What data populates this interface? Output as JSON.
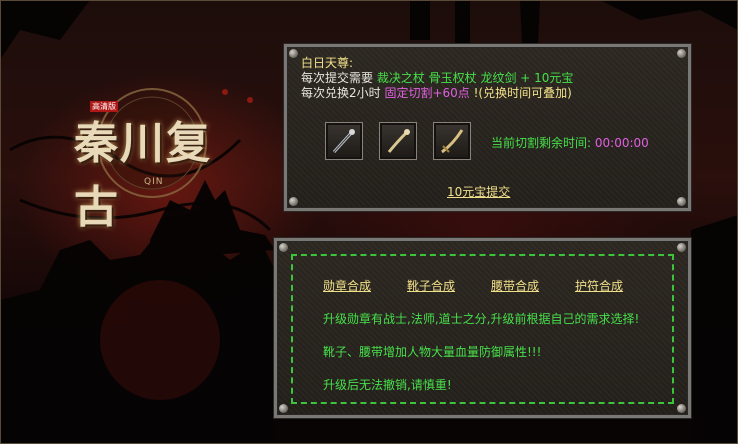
{
  "logo": {
    "title": "秦川复古",
    "seal": "高清版",
    "subtitle": "QIN"
  },
  "top_panel": {
    "heading": "白日天尊:",
    "line1_prefix": "每次提交需要",
    "line1_items": "裁决之杖 骨玉权杖 龙纹剑 + 10元宝",
    "line2_prefix": "每次兑换2小时",
    "line2_highlight": "固定切割+60点",
    "line2_suffix": "!(兑换时间可叠加)",
    "timer_label": "当前切割剩余时间:",
    "timer_value": "00:00:00",
    "items": [
      {
        "name": "裁决之杖",
        "icon": "staff-icon"
      },
      {
        "name": "骨玉权杖",
        "icon": "scepter-icon"
      },
      {
        "name": "龙纹剑",
        "icon": "sword-icon"
      }
    ],
    "submit_label": "10元宝提交"
  },
  "bottom_panel": {
    "tabs": [
      "勋章合成",
      "靴子合成",
      "腰带合成",
      "护符合成"
    ],
    "info": [
      "升级勋章有战士,法师,道士之分,升级前根据自己的需求选择!",
      "靴子、腰带增加人物大量血量防御属性!!!",
      "升级后无法撤销,请慎重!"
    ]
  },
  "colors": {
    "accent_green": "#46e04a",
    "accent_yellow": "#f2e28a",
    "accent_magenta": "#e060e0",
    "panel_border": "#7a7874"
  }
}
